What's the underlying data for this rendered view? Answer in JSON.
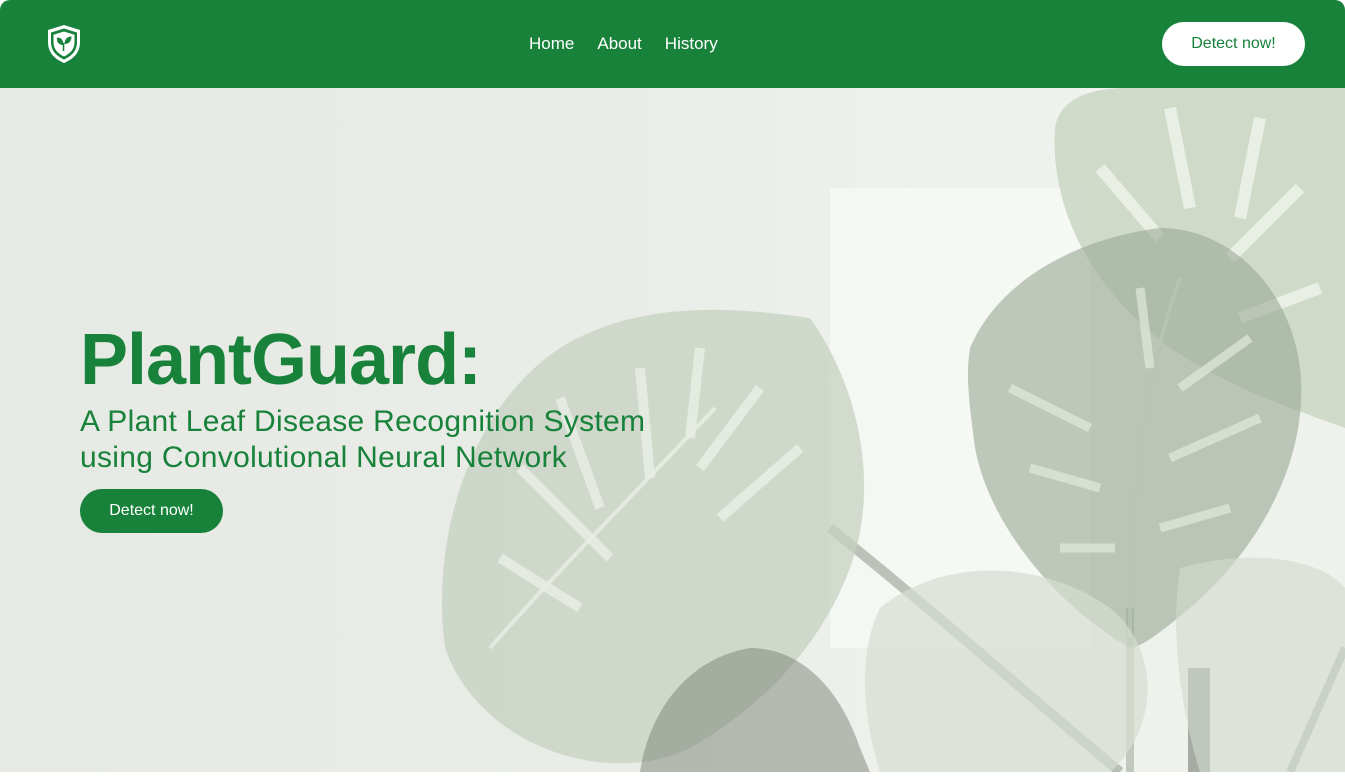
{
  "brand": {
    "logo_icon": "shield-leaf-icon"
  },
  "nav": {
    "links": [
      {
        "label": "Home"
      },
      {
        "label": "About"
      },
      {
        "label": "History"
      }
    ],
    "cta_label": "Detect now!"
  },
  "hero": {
    "title": "PlantGuard:",
    "subtitle_line1": "A Plant Leaf Disease Recognition System",
    "subtitle_line2": "using Convolutional Neural Network",
    "cta_label": "Detect now!"
  },
  "colors": {
    "brand_green": "#18823b",
    "hero_background": "#e9ece7",
    "white": "#ffffff"
  }
}
